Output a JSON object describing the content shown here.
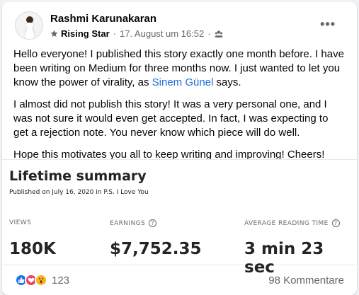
{
  "post": {
    "author": "Rashmi Karunakaran",
    "badge": "Rising Star",
    "separator": "·",
    "timestamp": "17. August um 16:52",
    "separator2": "·",
    "more_label": "•••",
    "paragraph1_before": "Hello everyone! I published this story exactly one month before. I have been writing on Medium for three months now. I just wanted to let you know the power of virality, as ",
    "mention": "Sinem Günel",
    "paragraph1_after": " says.",
    "paragraph2": "I almost did not publish this story! It was a very personal one, and I was not sure it would even get accepted. In fact, I was expecting to get a rejection note.  You never know which piece will do well.",
    "paragraph3": "Hope this motivates you all to keep writing and improving! Cheers!"
  },
  "image": {
    "title": "Lifetime summary",
    "subtitle": "Published on July 16, 2020 in P.S. I Love You",
    "stats": [
      {
        "label": "VIEWS",
        "value": "180K"
      },
      {
        "label": "EARNINGS",
        "value": "$7,752.35",
        "help": "?"
      },
      {
        "label": "AVERAGE READING TIME",
        "value": "3 min 23 sec",
        "help": "?"
      }
    ]
  },
  "footer": {
    "reactions": [
      "like-icon",
      "love-icon",
      "wow-icon"
    ],
    "reaction_count": "123",
    "comments": "98 Kommentare"
  },
  "colors": {
    "link": "#216fdb",
    "like": "#1877f2",
    "love": "#f33e58",
    "wow": "#f7b125"
  }
}
